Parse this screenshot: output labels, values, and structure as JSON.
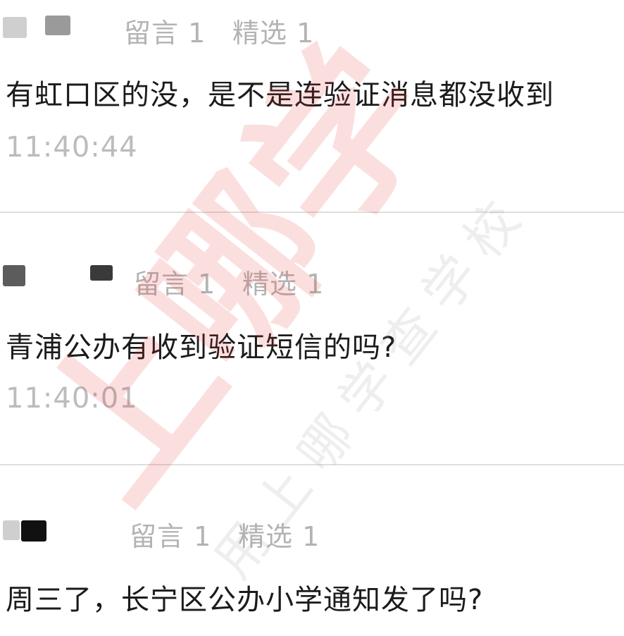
{
  "comments": [
    {
      "likes_label": "留言 1",
      "featured_label": "精选 1",
      "text": "有虹口区的没，是不是连验证消息都没收到",
      "time": "11:40:44"
    },
    {
      "likes_label": "留言 1",
      "featured_label": "精选 1",
      "text": "青浦公办有收到验证短信的吗?",
      "time": "11:40:01"
    },
    {
      "likes_label": "留言 1",
      "featured_label": "精选 1",
      "text": "周三了，长宁区公办小学通知发了吗?"
    }
  ],
  "watermark": {
    "main": "上哪学",
    "sub": "用上哪学查学校",
    "main_color": "#e53935"
  }
}
